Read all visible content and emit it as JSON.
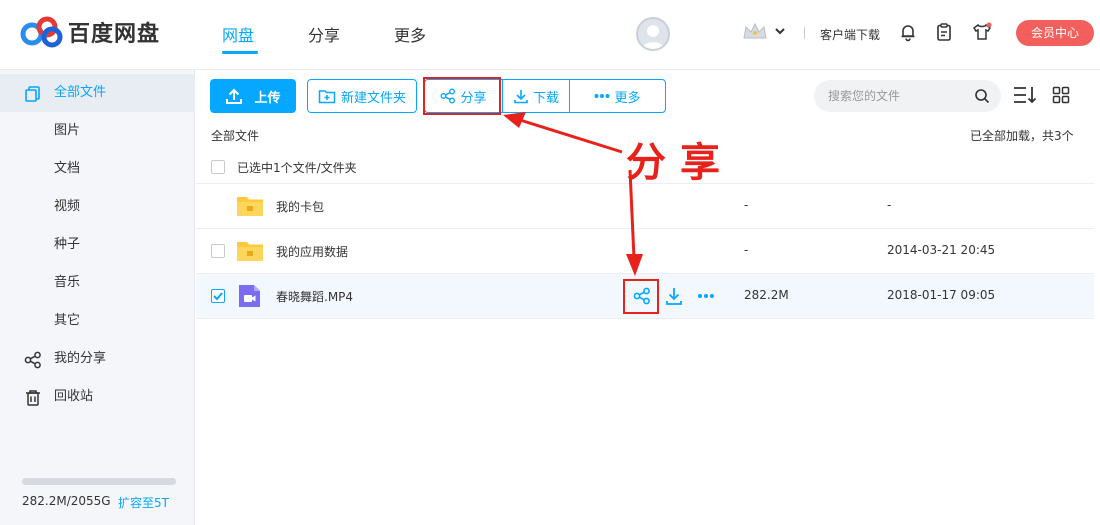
{
  "app": {
    "name": "百度网盘"
  },
  "nav": {
    "items": [
      "网盘",
      "分享",
      "更多"
    ]
  },
  "header": {
    "client_download": "客户端下载",
    "vip_button": "会员中心"
  },
  "sidebar": {
    "items": [
      "全部文件",
      "图片",
      "文档",
      "视频",
      "种子",
      "音乐",
      "其它",
      "我的分享",
      "回收站"
    ],
    "quota_text": "282.2M/2055G",
    "quota_link": "扩容至5T",
    "quota_fraction": 0.0001
  },
  "toolbar": {
    "upload": "上传",
    "new_folder": "新建文件夹",
    "share": "分享",
    "download": "下载",
    "more": "更多",
    "search_placeholder": "搜索您的文件"
  },
  "list": {
    "breadcrumb": "全部文件",
    "loaded_text": "已全部加载，共3个",
    "selection_text": "已选中1个文件/文件夹",
    "rows": [
      {
        "name": "我的卡包",
        "size": "-",
        "date": "-",
        "type": "folder",
        "checked": false
      },
      {
        "name": "我的应用数据",
        "size": "-",
        "date": "2014-03-21 20:45",
        "type": "folder",
        "checked": false
      },
      {
        "name": "春晓舞蹈.MP4",
        "size": "282.2M",
        "date": "2018-01-17 09:05",
        "type": "video",
        "checked": true
      }
    ]
  },
  "annotation": {
    "text": "分享"
  },
  "colors": {
    "accent": "#06a7ff",
    "annotation": "#e8211a",
    "vip": "#f25f5c"
  }
}
